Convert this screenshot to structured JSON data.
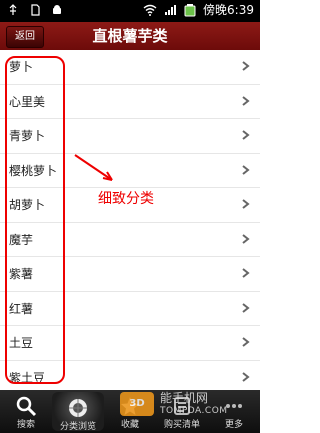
{
  "status_bar": {
    "time": "傍晚6:39",
    "icons": [
      "usb-icon",
      "sd-card-icon",
      "android-icon",
      "wifi-icon",
      "signal-icon",
      "battery-icon"
    ]
  },
  "header": {
    "back_label": "返回",
    "title": "直根薯芋类"
  },
  "list": {
    "items": [
      {
        "label": "萝卜"
      },
      {
        "label": "心里美"
      },
      {
        "label": "青萝卜"
      },
      {
        "label": "樱桃萝卜"
      },
      {
        "label": "胡萝卜"
      },
      {
        "label": "魔芋"
      },
      {
        "label": "紫薯"
      },
      {
        "label": "红薯"
      },
      {
        "label": "土豆"
      },
      {
        "label": "紫土豆"
      }
    ]
  },
  "annotation": {
    "text": "细致分类",
    "color": "#e00000"
  },
  "tabbar": {
    "tabs": [
      {
        "label": "搜索"
      },
      {
        "label": "分类浏览"
      },
      {
        "label": "收藏"
      },
      {
        "label": "购买清单"
      },
      {
        "label": "更多"
      }
    ],
    "active_index": 1
  },
  "watermark": {
    "title": "能手机网",
    "url": "TOMPDA.COM",
    "logo_text": "3D"
  },
  "colors": {
    "title_bar": "#7d1210",
    "accent": "#e00000"
  }
}
